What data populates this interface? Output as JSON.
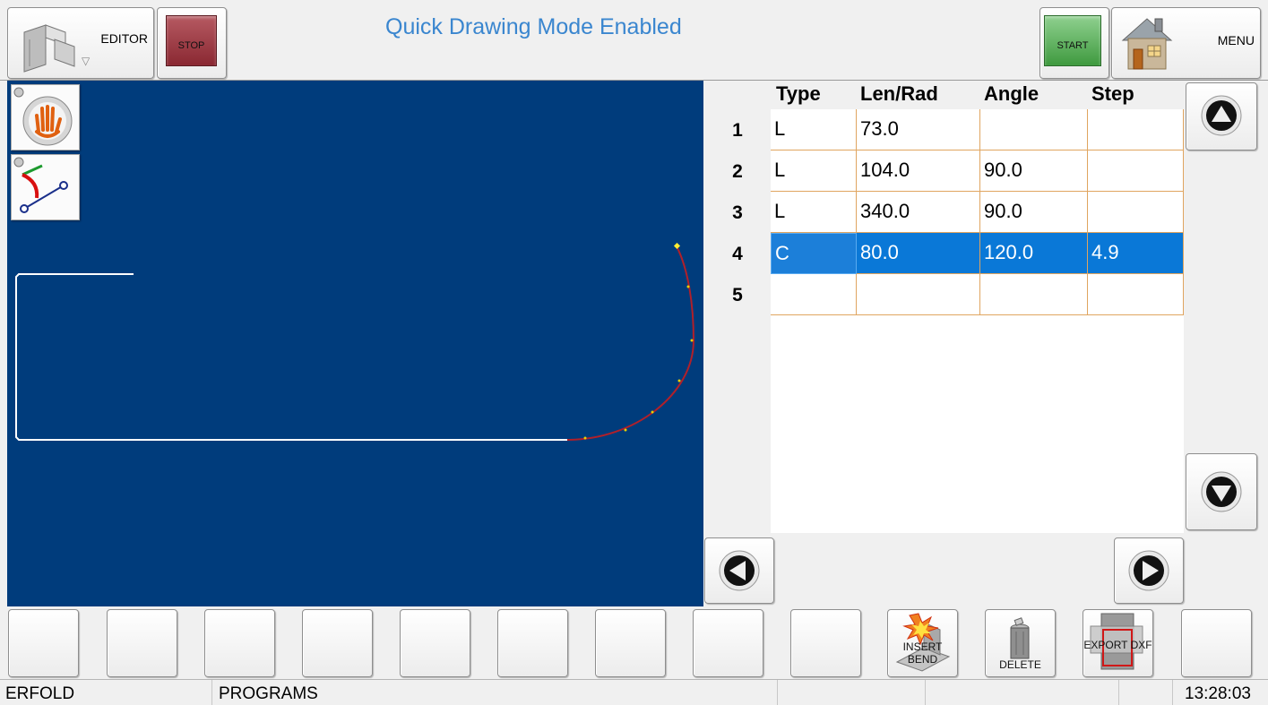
{
  "header": {
    "editor_label": "EDITOR",
    "stop_label": "STOP",
    "title": "Quick Drawing Mode Enabled",
    "start_label": "START",
    "menu_label": "MENU",
    "title_color": "#3a86cf"
  },
  "canvas": {
    "background": "#003c7c",
    "tools": [
      "hand-icon",
      "curve-tool-icon"
    ]
  },
  "table": {
    "columns": [
      "Type",
      "Len/Rad",
      "Angle",
      "Step"
    ],
    "rows": [
      {
        "num": "1",
        "type": "L",
        "len": "73.0",
        "angle": "",
        "step": ""
      },
      {
        "num": "2",
        "type": "L",
        "len": "104.0",
        "angle": "90.0",
        "step": ""
      },
      {
        "num": "3",
        "type": "L",
        "len": "340.0",
        "angle": "90.0",
        "step": ""
      },
      {
        "num": "4",
        "type": "C",
        "len": "80.0",
        "angle": "120.0",
        "step": "4.9"
      },
      {
        "num": "5",
        "type": "",
        "len": "",
        "angle": "",
        "step": ""
      }
    ],
    "selected_row": 4,
    "selection_color": "#0a78d7"
  },
  "softkeys": {
    "insert_bend": "INSERT BEND",
    "delete": "DELETE",
    "export_dxf": "EXPORT DXF"
  },
  "status": {
    "left": "ERFOLD",
    "programs": "PROGRAMS",
    "time": "13:28:03"
  }
}
